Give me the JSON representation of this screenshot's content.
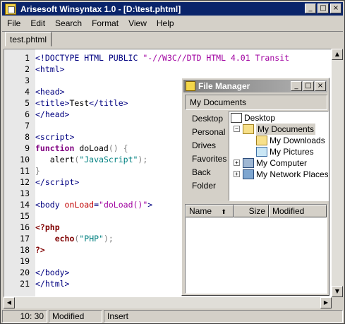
{
  "app": {
    "title": "Arisesoft Winsyntax 1.0 - [D:\\test.phtml]",
    "title_buttons": [
      "_",
      "□",
      "×"
    ]
  },
  "menu": [
    "File",
    "Edit",
    "Search",
    "Format",
    "View",
    "Help"
  ],
  "tabs": [
    {
      "label": "test.phtml"
    }
  ],
  "editor": {
    "lines": [
      {
        "n": "1",
        "html": "<span class='c-tag'>&lt;!DOCTYPE HTML PUBLIC </span><span class='c-str'>\"-//W3C//DTD HTML 4.01 Transit</span>"
      },
      {
        "n": "2",
        "html": "<span class='c-tag'>&lt;html&gt;</span>"
      },
      {
        "n": "3",
        "html": ""
      },
      {
        "n": "4",
        "html": "<span class='c-tag'>&lt;head&gt;</span>"
      },
      {
        "n": "5",
        "html": "<span class='c-tag'>&lt;title&gt;</span>Test<span class='c-tag'>&lt;/title&gt;</span>"
      },
      {
        "n": "6",
        "html": "<span class='c-tag'>&lt;/head&gt;</span>"
      },
      {
        "n": "7",
        "html": ""
      },
      {
        "n": "8",
        "html": "<span class='c-tag'>&lt;script&gt;</span>"
      },
      {
        "n": "9",
        "html": "<span class='c-kw'>function</span> doLoad<span class='c-gray'>() {</span>"
      },
      {
        "n": "10",
        "html": "   alert<span class='c-gray'>(</span><span class='c-teal'>\"JavaScript\"</span><span class='c-gray'>);</span>"
      },
      {
        "n": "11",
        "html": "<span class='c-gray'>}</span>"
      },
      {
        "n": "12",
        "html": "<span class='c-tag'>&lt;/script&gt;</span>"
      },
      {
        "n": "13",
        "html": ""
      },
      {
        "n": "14",
        "html": "<span class='c-tag'>&lt;body </span><span class='c-red'>onLoad</span><span class='c-tag'>=</span><span class='c-str'>\"doLoad()\"</span><span class='c-tag'>&gt;</span>"
      },
      {
        "n": "15",
        "html": ""
      },
      {
        "n": "16",
        "html": "<span class='c-php'>&lt;?php</span>"
      },
      {
        "n": "17",
        "html": "    <span class='c-php'>echo</span><span class='c-gray'>(</span><span class='c-teal'>\"PHP\"</span><span class='c-gray'>);</span>"
      },
      {
        "n": "18",
        "html": "<span class='c-php'>?&gt;</span>"
      },
      {
        "n": "19",
        "html": ""
      },
      {
        "n": "20",
        "html": "<span class='c-tag'>&lt;/body&gt;</span>"
      },
      {
        "n": "21",
        "html": "<span class='c-tag'>&lt;/html&gt;</span>"
      }
    ]
  },
  "statusbar": {
    "position": "10: 30",
    "modified": "Modified",
    "mode": "Insert"
  },
  "file_manager": {
    "title": "File Manager",
    "path": "My Documents",
    "side_items": [
      "Desktop",
      "Personal",
      "Drives",
      "Favorites",
      "Back",
      "Folder"
    ],
    "tree": [
      {
        "label": "Desktop",
        "icon": "desktop-icon"
      },
      {
        "label": "My Documents",
        "icon": "folder-open-icon",
        "selected": true
      },
      {
        "label": "My Downloads",
        "icon": "folder-icon"
      },
      {
        "label": "My Pictures",
        "icon": "pictures-folder-icon"
      },
      {
        "label": "My Computer",
        "icon": "computer-icon"
      },
      {
        "label": "My Network Places",
        "icon": "network-icon"
      }
    ],
    "columns": [
      "Name",
      "Size",
      "Modified"
    ],
    "sort_glyph": "⬆"
  }
}
